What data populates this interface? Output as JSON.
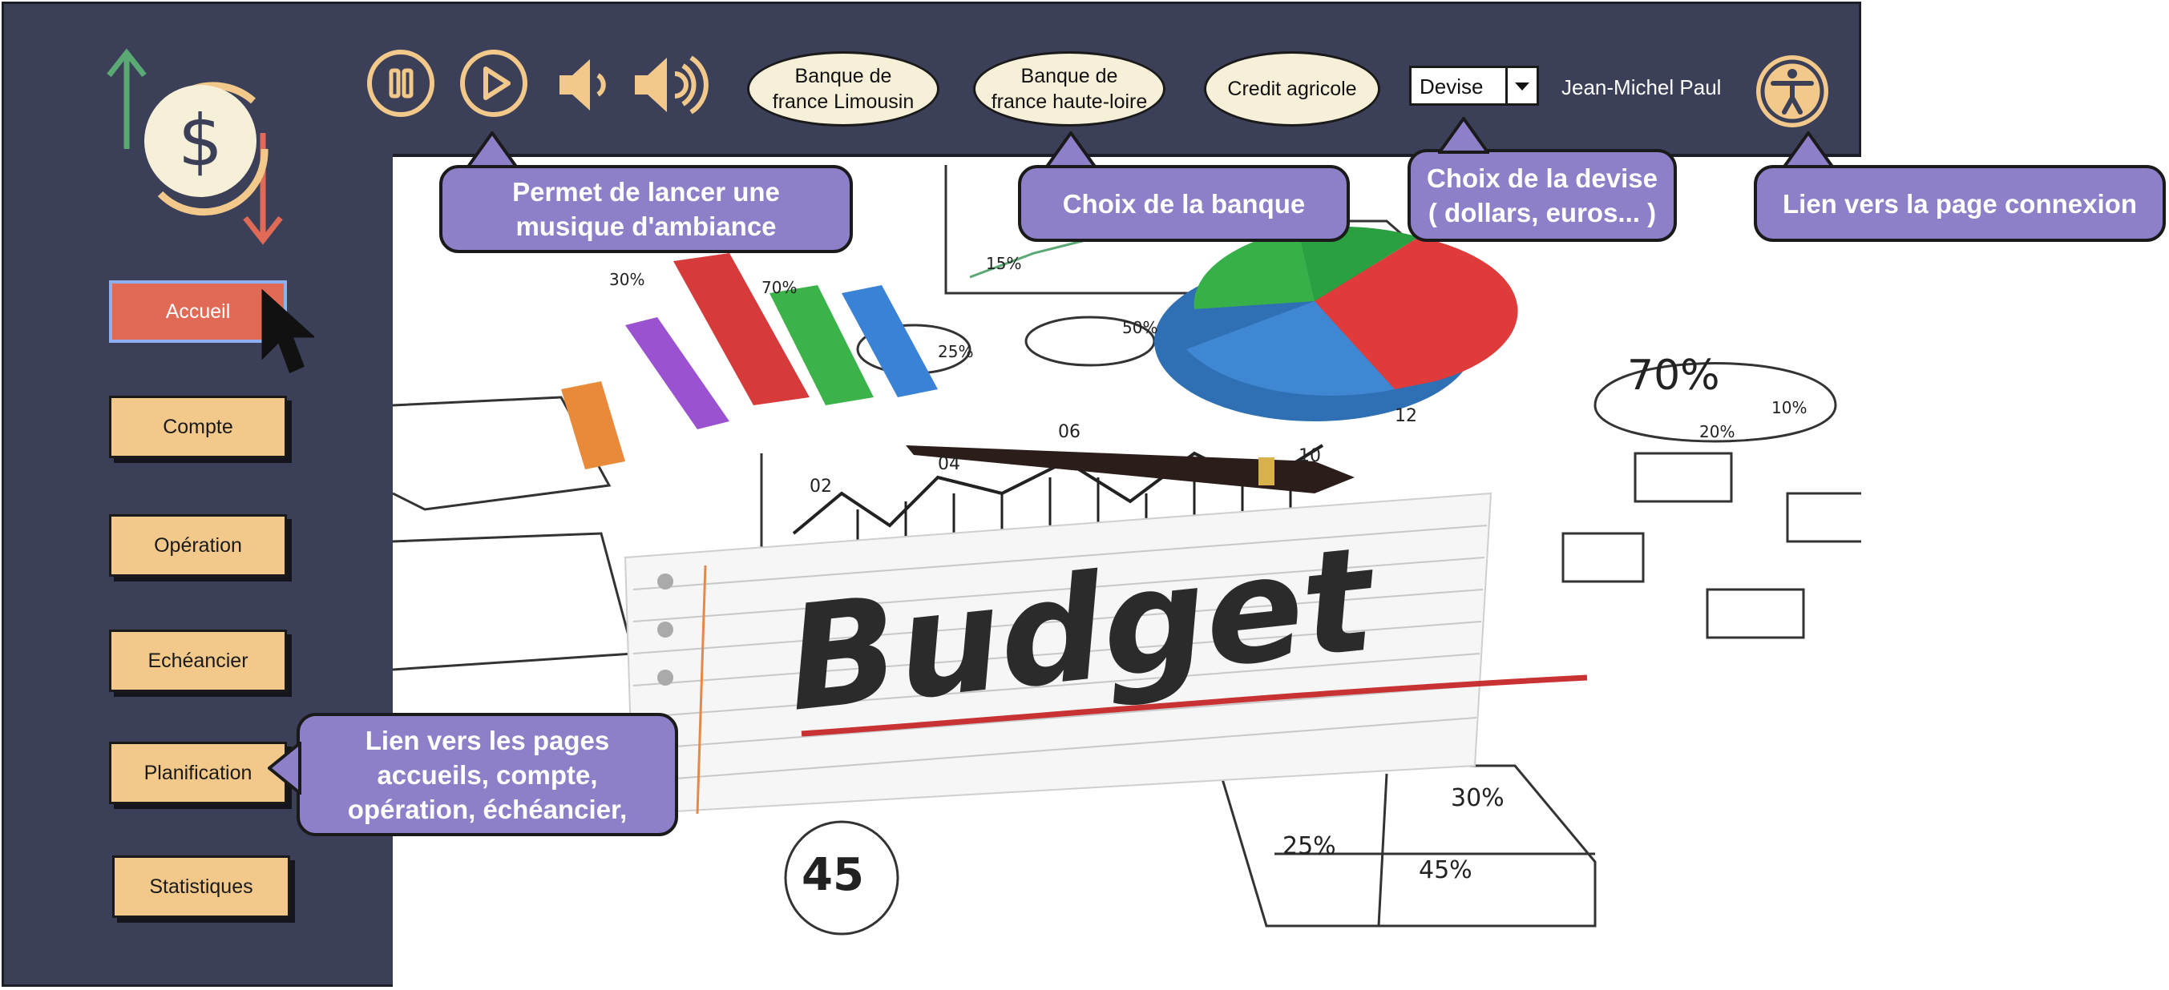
{
  "colors": {
    "panel": "#3b4058",
    "nav_button": "#f2c98a",
    "nav_active": "#e06a55",
    "callout": "#8e7fc9",
    "bank_button": "#f7f0d9"
  },
  "logo": {
    "icon": "dollar-exchange-icon"
  },
  "sidebar": {
    "items": [
      {
        "label": "Accueil",
        "active": true
      },
      {
        "label": "Compte"
      },
      {
        "label": "Opération"
      },
      {
        "label": "Echéancier"
      },
      {
        "label": "Planification"
      },
      {
        "label": "Statistiques"
      }
    ]
  },
  "media": {
    "pause_icon": "pause-icon",
    "play_icon": "play-icon",
    "volume_down_icon": "volume-down-icon",
    "volume_up_icon": "volume-up-icon"
  },
  "banks": [
    {
      "label": "Banque de\nfrance Limousin"
    },
    {
      "label": "Banque de\nfrance haute-loire"
    },
    {
      "label": "Credit agricole"
    }
  ],
  "currency": {
    "value": "Devise"
  },
  "user": {
    "name": "Jean-Michel Paul",
    "icon": "accessibility-icon"
  },
  "callouts": {
    "music": "Permet de lancer une\nmusique d'ambiance",
    "bank": "Choix de la banque",
    "currency": "Choix de la devise\n( dollars, euros... )",
    "login": "Lien vers la page connexion",
    "nav": "Lien vers les pages\naccueils, compte,\nopération, échéancier,"
  },
  "image": {
    "title": "Budget",
    "labels": [
      "15%",
      "30%",
      "70%",
      "25%",
      "50%",
      "70%",
      "10%",
      "20%",
      "02",
      "04",
      "06",
      "10",
      "12",
      "45",
      "25%",
      "30%",
      "45%"
    ]
  }
}
